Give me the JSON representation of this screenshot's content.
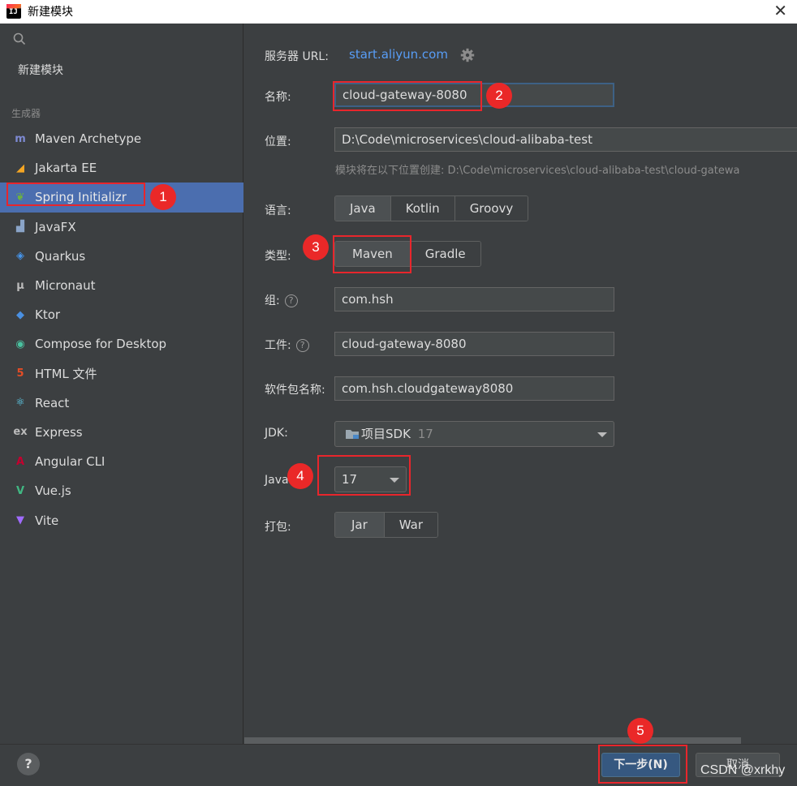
{
  "window": {
    "title": "新建模块",
    "close_glyph": "✕"
  },
  "sidebar": {
    "new_module": "新建模块",
    "generators_label": "生成器",
    "items": [
      {
        "label": "Maven Archetype",
        "icon": "maven-icon",
        "glyph": "m",
        "color": "#7e8ad3"
      },
      {
        "label": "Jakarta EE",
        "icon": "jakarta-icon",
        "glyph": "◢",
        "color": "#f5a623"
      },
      {
        "label": "Spring Initializr",
        "icon": "spring-icon",
        "glyph": "❦",
        "color": "#6db33f"
      },
      {
        "label": "JavaFX",
        "icon": "javafx-icon",
        "glyph": "▟",
        "color": "#8aa4c8"
      },
      {
        "label": "Quarkus",
        "icon": "quarkus-icon",
        "glyph": "◈",
        "color": "#4695eb"
      },
      {
        "label": "Micronaut",
        "icon": "micronaut-icon",
        "glyph": "μ",
        "color": "#bbbbbb"
      },
      {
        "label": "Ktor",
        "icon": "ktor-icon",
        "glyph": "◆",
        "color": "#4a90e2"
      },
      {
        "label": "Compose for Desktop",
        "icon": "compose-icon",
        "glyph": "◉",
        "color": "#4ac2a0"
      },
      {
        "label": "HTML 文件",
        "icon": "html5-icon",
        "glyph": "5",
        "color": "#e44d26"
      },
      {
        "label": "React",
        "icon": "react-icon",
        "glyph": "⚛",
        "color": "#61dafb"
      },
      {
        "label": "Express",
        "icon": "express-icon",
        "glyph": "ex",
        "color": "#bbbbbb"
      },
      {
        "label": "Angular CLI",
        "icon": "angular-icon",
        "glyph": "A",
        "color": "#c3002f"
      },
      {
        "label": "Vue.js",
        "icon": "vue-icon",
        "glyph": "V",
        "color": "#41b883"
      },
      {
        "label": "Vite",
        "icon": "vite-icon",
        "glyph": "▼",
        "color": "#a06bff"
      }
    ],
    "selected_index": 2
  },
  "form": {
    "server_url_label": "服务器 URL:",
    "server_url": "start.aliyun.com",
    "name_label": "名称:",
    "name_value": "cloud-gateway-8080",
    "location_label": "位置:",
    "location_value": "D:\\Code\\microservices\\cloud-alibaba-test",
    "location_hint": "模块将在以下位置创建: D:\\Code\\microservices\\cloud-alibaba-test\\cloud-gatewa",
    "language_label": "语言:",
    "languages": [
      "Java",
      "Kotlin",
      "Groovy"
    ],
    "type_label": "类型:",
    "types": [
      "Maven",
      "Gradle"
    ],
    "group_label": "组:",
    "group_value": "com.hsh",
    "artifact_label": "工件:",
    "artifact_value": "cloud-gateway-8080",
    "package_label": "软件包名称:",
    "package_value": "com.hsh.cloudgateway8080",
    "jdk_label": "JDK:",
    "jdk_value": "项目SDK",
    "jdk_version": "17",
    "java_label": "Java",
    "java_value": "17",
    "packaging_label": "打包:",
    "packagings": [
      "Jar",
      "War"
    ]
  },
  "footer": {
    "help": "?",
    "next": "下一步(N)",
    "cancel": "取消",
    "watermark": "CSDN @xrkhy"
  },
  "annotations": [
    "1",
    "2",
    "3",
    "4",
    "5"
  ],
  "colors": {
    "selection": "#4b6eaf",
    "link": "#589df6",
    "annotation": "#e8262c",
    "primary_button": "#365880"
  }
}
